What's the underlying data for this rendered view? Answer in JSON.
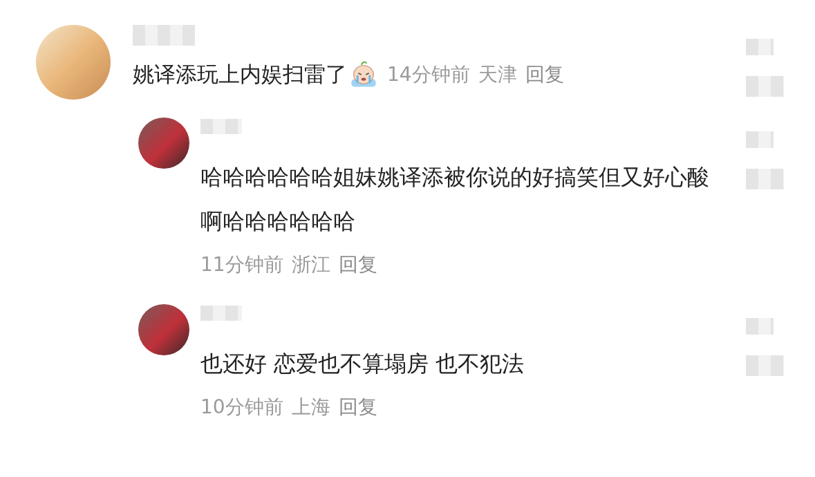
{
  "comment": {
    "text": "姚译添玩上内娱扫雷了",
    "time": "14分钟前",
    "location": "天津",
    "reply_label": "回复"
  },
  "replies": [
    {
      "text": "哈哈哈哈哈哈姐妹姚译添被你说的好搞笑但又好心酸啊哈哈哈哈哈哈",
      "time": "11分钟前",
      "location": "浙江",
      "reply_label": "回复"
    },
    {
      "text": "也还好 恋爱也不算塌房 也不犯法",
      "time": "10分钟前",
      "location": "上海",
      "reply_label": "回复"
    }
  ]
}
